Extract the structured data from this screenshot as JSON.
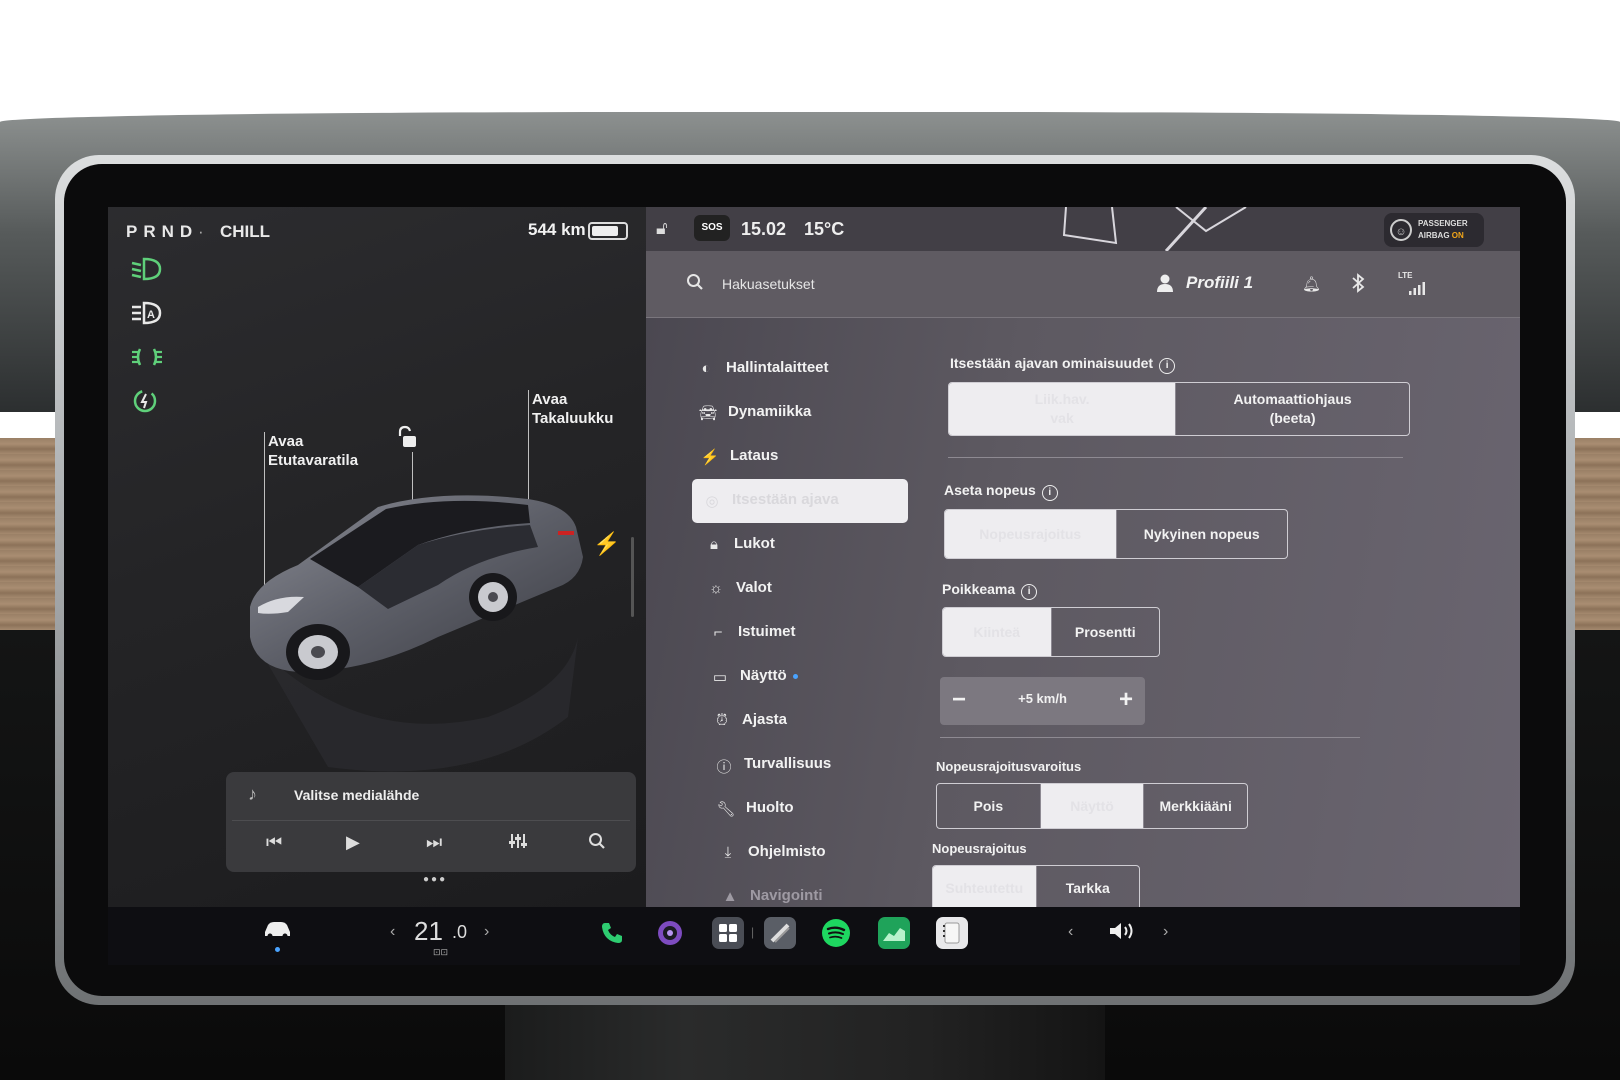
{
  "status": {
    "gears": "PRND",
    "drive_mode": "CHILL",
    "range": "544 km",
    "battery_level": 0.92,
    "time": "15.02",
    "temperature": "15°C",
    "sos": "SOS",
    "airbag_line1": "PASSENGER",
    "airbag_line2": "AIRBAG",
    "airbag_state": "ON"
  },
  "car_panel": {
    "frunk_label_1": "Avaa",
    "frunk_label_2": "Etutavaratila",
    "trunk_label_1": "Avaa",
    "trunk_label_2": "Takaluukku"
  },
  "media": {
    "title": "Valitse medialähde"
  },
  "settings": {
    "search_placeholder": "Hakuasetukset",
    "profile": "Profiili 1",
    "lte": "LTE",
    "nav": [
      {
        "label": "Hallintalaitteet",
        "icon": "toggle-icon"
      },
      {
        "label": "Dynamiikka",
        "icon": "car-icon"
      },
      {
        "label": "Lataus",
        "icon": "bolt-icon"
      },
      {
        "label": "Itsestään ajava",
        "icon": "steering-wheel-icon"
      },
      {
        "label": "Lukot",
        "icon": "lock-icon"
      },
      {
        "label": "Valot",
        "icon": "sun-icon"
      },
      {
        "label": "Istuimet",
        "icon": "seat-icon"
      },
      {
        "label": "Näyttö",
        "icon": "display-icon"
      },
      {
        "label": "Ajasta",
        "icon": "alarm-clock-icon"
      },
      {
        "label": "Turvallisuus",
        "icon": "alert-circle-icon"
      },
      {
        "label": "Huolto",
        "icon": "wrench-icon"
      },
      {
        "label": "Ohjelmisto",
        "icon": "download-icon"
      },
      {
        "label": "Navigointi",
        "icon": "navigation-icon"
      }
    ],
    "autopilot": {
      "title": "Itsestään ajavan ominaisuudet",
      "opt1": "Liik.hav.\nvak",
      "opt2": "Automaattiohjaus\n(beeta)"
    },
    "set_speed": {
      "title": "Aseta nopeus",
      "opt1": "Nopeusrajoitus",
      "opt2": "Nykyinen nopeus"
    },
    "offset": {
      "title": "Poikkeama",
      "opt1": "Kiinteä",
      "opt2": "Prosentti",
      "value": "+5 km/h"
    },
    "speed_warning": {
      "title": "Nopeusrajoitusvaroitus",
      "opt1": "Pois",
      "opt2": "Näyttö",
      "opt3": "Merkkiääni"
    },
    "speed_limit": {
      "title": "Nopeusrajoitus",
      "opt1": "Suhteutettu",
      "opt2": "Tarkka"
    }
  },
  "bottom": {
    "temp_main": "21",
    "temp_dec": ".0"
  },
  "colors": {
    "accent_green": "#5fd07a",
    "accent_blue": "#4aa3ff",
    "airbag_on": "#f3a71a"
  }
}
